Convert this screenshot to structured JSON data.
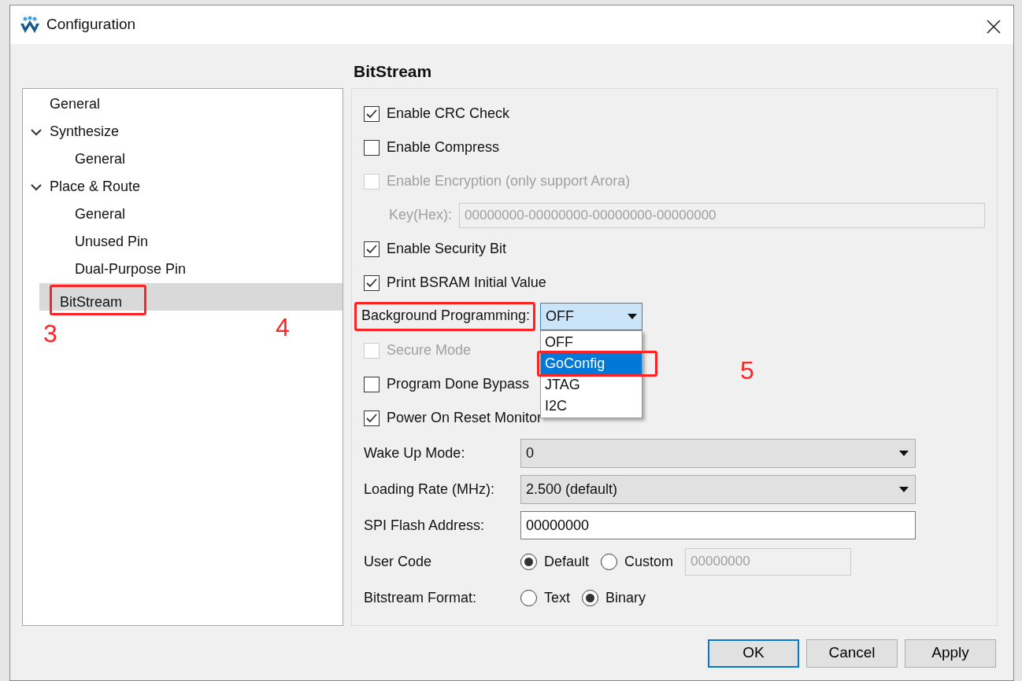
{
  "window": {
    "title": "Configuration"
  },
  "tree": [
    {
      "label": "General",
      "selected": false
    },
    {
      "label": "Synthesize",
      "expanded": true,
      "selected": false,
      "children": [
        {
          "label": "General",
          "selected": false
        }
      ]
    },
    {
      "label": "Place & Route",
      "expanded": true,
      "selected": false,
      "children": [
        {
          "label": "General",
          "selected": false
        },
        {
          "label": "Unused Pin",
          "selected": false
        },
        {
          "label": "Dual-Purpose Pin",
          "selected": false
        }
      ]
    },
    {
      "label": "BitStream",
      "selected": true,
      "highlighted": true
    }
  ],
  "page_title": "BitStream",
  "options": [
    {
      "kind": "checkbox",
      "label": "Enable CRC Check",
      "checked": true,
      "disabled": false
    },
    {
      "kind": "checkbox",
      "label": "Enable Compress",
      "checked": false,
      "disabled": false
    },
    {
      "kind": "checkbox",
      "label": "Enable Encryption (only support Arora)",
      "checked": false,
      "disabled": true
    },
    {
      "kind": "keyfield",
      "label": "Key(Hex):",
      "value": "00000000-00000000-00000000-00000000",
      "disabled": true
    },
    {
      "kind": "checkbox",
      "label": "Enable Security Bit",
      "checked": true,
      "disabled": false
    },
    {
      "kind": "checkbox",
      "label": "Print BSRAM Initial Value",
      "checked": true,
      "disabled": false
    },
    {
      "kind": "dropdown",
      "label": "Background Programming:",
      "value": "OFF",
      "highlighted": true,
      "expanded": true,
      "menu": [
        {
          "label": "OFF",
          "hovered": false,
          "highlighted": false
        },
        {
          "label": "GoConfig",
          "hovered": true,
          "highlighted": true
        },
        {
          "label": "JTAG",
          "hovered": false,
          "highlighted": false
        },
        {
          "label": "I2C",
          "hovered": false,
          "highlighted": false
        }
      ]
    },
    {
      "kind": "checkbox",
      "label": "Secure Mode",
      "checked": false,
      "disabled": true
    },
    {
      "kind": "checkbox",
      "label": "Program Done Bypass",
      "checked": false,
      "disabled": false
    },
    {
      "kind": "checkbox",
      "label": "Power On Reset Monitor",
      "checked": true,
      "disabled": false
    },
    {
      "kind": "select",
      "label": "Wake Up Mode:",
      "value": "0"
    },
    {
      "kind": "select",
      "label": "Loading Rate (MHz):",
      "value": "2.500 (default)"
    },
    {
      "kind": "text",
      "label": "SPI Flash Address:",
      "value": "00000000"
    },
    {
      "kind": "radio",
      "label": "User Code",
      "choices": [
        {
          "label": "Default",
          "selected": true
        },
        {
          "label": "Custom",
          "selected": false
        }
      ],
      "field": {
        "value": "00000000",
        "disabled": true
      }
    },
    {
      "kind": "radio",
      "label": "Bitstream Format:",
      "choices": [
        {
          "label": "Text",
          "selected": false
        },
        {
          "label": "Binary",
          "selected": true
        }
      ]
    }
  ],
  "buttons": [
    {
      "label": "OK",
      "default": true
    },
    {
      "label": "Cancel",
      "default": false
    },
    {
      "label": "Apply",
      "default": false
    }
  ],
  "annotations": [
    {
      "label": "3"
    },
    {
      "label": "4"
    },
    {
      "label": "5"
    }
  ]
}
